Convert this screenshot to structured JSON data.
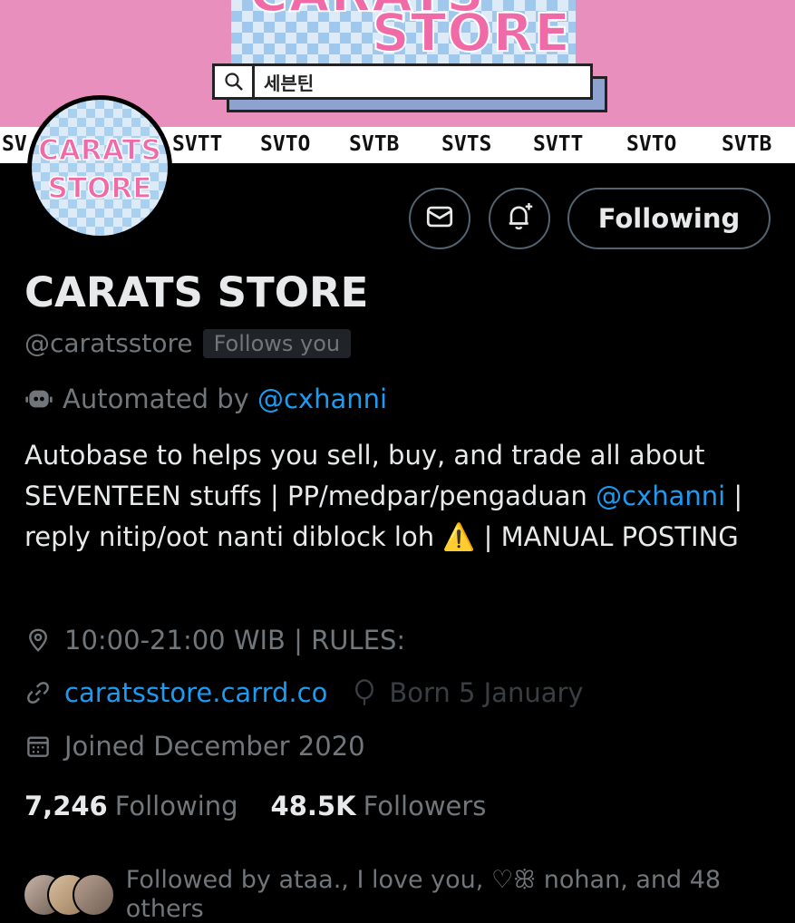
{
  "banner": {
    "top_word": "CARATS",
    "word": "STORE",
    "search_text": "세븐틴",
    "ticker": [
      "SV",
      "SVTT",
      "SVTO",
      "SVTB",
      "SVTS",
      "SVTT",
      "SVTO",
      "SVTB"
    ],
    "colors": {
      "pink": "#e88fbd",
      "checker_blue": "#9fc8ec"
    }
  },
  "avatar": {
    "line1": "CARATS",
    "line2": "STORE"
  },
  "actions": {
    "message_icon": "envelope-icon",
    "notify_icon": "bell-plus-icon",
    "following_label": "Following"
  },
  "profile": {
    "name": "CARATS STORE",
    "handle": "@caratsstore",
    "follows_you": "Follows you",
    "automated_prefix": "Automated by",
    "automated_handle": "@cxhanni",
    "bio_part1": "Autobase to helps you sell, buy, and trade all about SEVENTEEN stuffs | PP/medpar/pengaduan",
    "bio_mention": "@cxhanni",
    "bio_part2": "| reply nitip/oot nanti diblock loh ⚠️ | MANUAL POSTING",
    "location": "10:00-21:00 WIB | RULES:",
    "url": "caratsstore.carrd.co",
    "born": "Born 5 January",
    "joined": "Joined December 2020"
  },
  "stats": {
    "following_count": "7,246",
    "following_label": "Following",
    "followers_count": "48.5K",
    "followers_label": "Followers"
  },
  "followed_by": "Followed by ataa., I love you, ♡ꕥ nohan, and 48 others",
  "colors": {
    "link": "#1d9bf0",
    "muted": "#71767b",
    "text": "#e7e9ea",
    "background": "#000000"
  }
}
